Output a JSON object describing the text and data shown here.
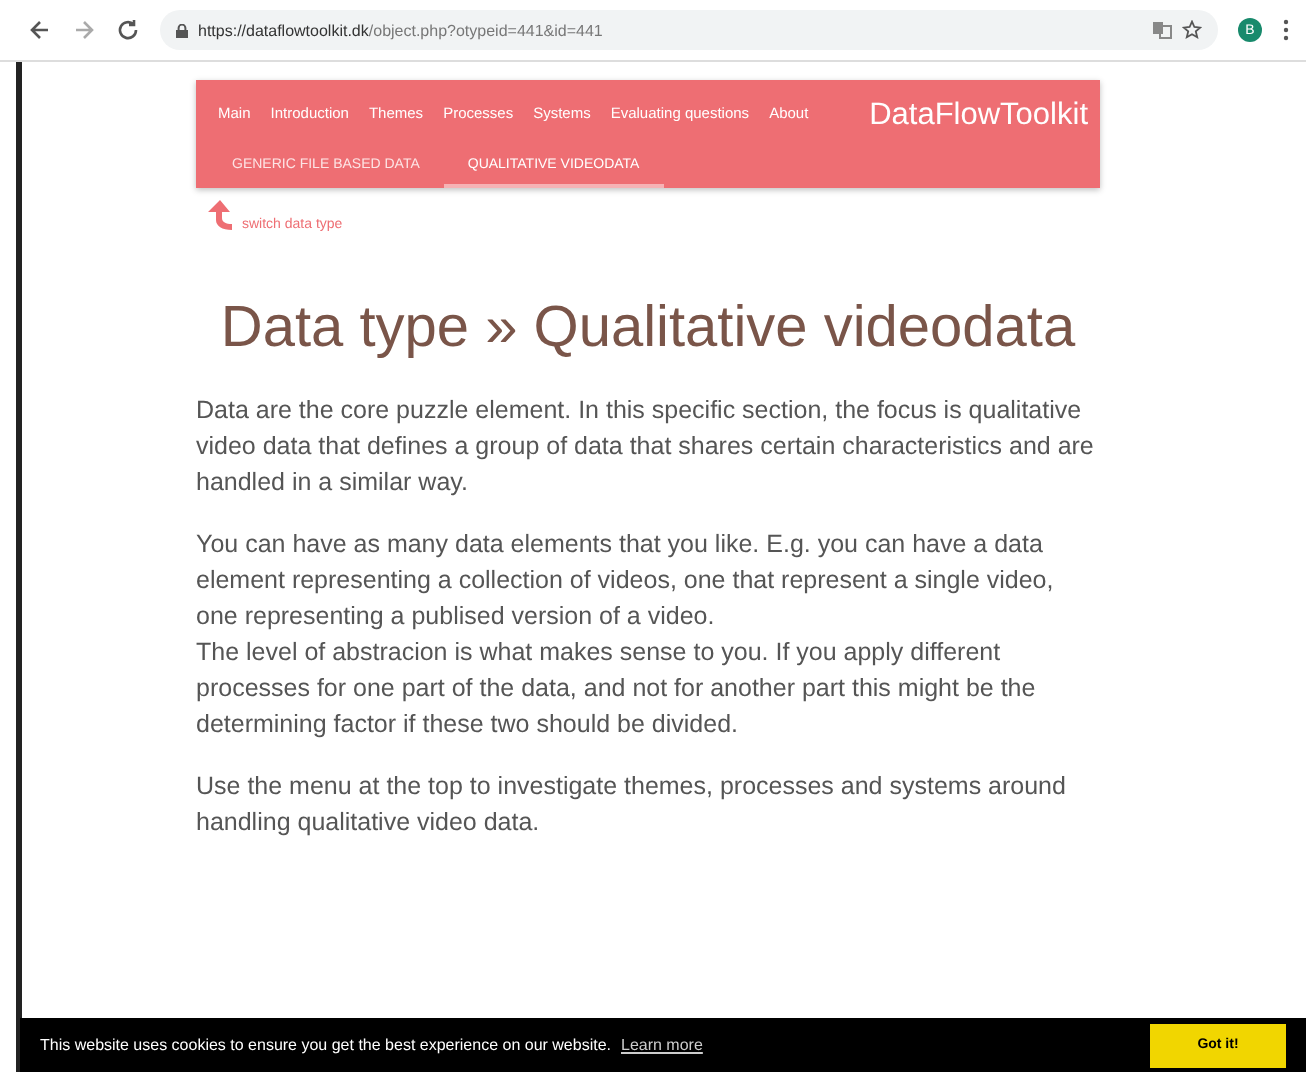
{
  "browser": {
    "url_host": "https://dataflowtoolkit.dk",
    "url_path": "/object.php?otypeid=441&id=441",
    "profile": "B"
  },
  "nav": {
    "items": [
      {
        "label": "Main"
      },
      {
        "label": "Introduction"
      },
      {
        "label": "Themes"
      },
      {
        "label": "Processes"
      },
      {
        "label": "Systems"
      },
      {
        "label": "Evaluating questions"
      },
      {
        "label": "About"
      }
    ],
    "brand": "DataFlowToolkit"
  },
  "tabs": [
    {
      "label": "GENERIC FILE BASED DATA",
      "selected": false
    },
    {
      "label": "QUALITATIVE VIDEODATA",
      "selected": true
    }
  ],
  "hint": "switch data type",
  "title": "Data type » Qualitative videodata",
  "paragraphs": [
    "Data are the core puzzle element. In this specific section, the focus is qualitative video data that defines a group of data that shares certain characteristics and are handled in a similar way.",
    "You can have as many data elements that you like. E.g. you can have a data element representing a collection of videos, one that represent a single video, one representing a publised version of a video.\nThe level of abstracion is what makes sense to you. If you apply different processes for one part of the data, and not for another part this might be the determining factor if these two should be divided.",
    "Use the menu at the top to investigate themes, processes and systems around handling qualitative video data."
  ],
  "cookie": {
    "message": "This website uses cookies to ensure you get the best experience on our website.",
    "link": "Learn more",
    "button": "Got it!"
  }
}
